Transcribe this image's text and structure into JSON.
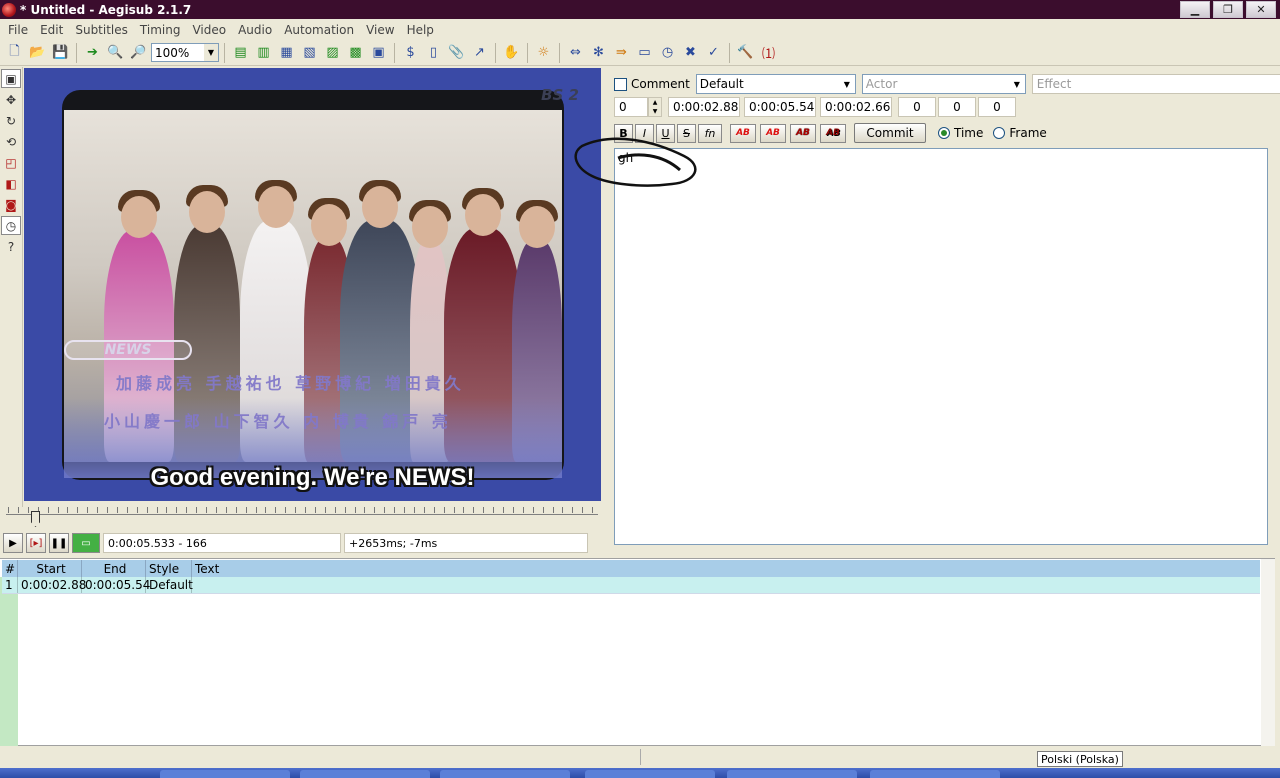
{
  "window": {
    "title": "* Untitled - Aegisub 2.1.7",
    "minimize": "▁",
    "restore": "❐",
    "close": "✕"
  },
  "menu": [
    "File",
    "Edit",
    "Subtitles",
    "Timing",
    "Video",
    "Audio",
    "Automation",
    "View",
    "Help"
  ],
  "toolbar": {
    "zoom": "100%"
  },
  "video": {
    "subtitle_text": "Good evening. We're NEWS!",
    "logo_text": "NEWS",
    "channel_mark": "BS 2",
    "names_row1": "加藤成亮 手越祐也 草野博紀 増田貴久",
    "names_row2": "小山慶一郎 山下智久 内 博貴 錦戸 亮"
  },
  "video_controls": {
    "time_position": "0:00:05.533 - 166",
    "offset": "+2653ms; -7ms"
  },
  "editor": {
    "comment_label": "Comment",
    "style": "Default",
    "actor_placeholder": "Actor",
    "effect_placeholder": "Effect",
    "layer": "0",
    "start_time": "0:00:02.88",
    "end_time": "0:00:05.54",
    "duration": "0:00:02.66",
    "margin_left": "0",
    "margin_right": "0",
    "margin_vertical": "0",
    "bold": "B",
    "italic": "I",
    "underline": "U",
    "strike": "S",
    "font": "fn",
    "color_label": "AB",
    "commit_label": "Commit",
    "time_label": "Time",
    "frame_label": "Frame",
    "text": "gh"
  },
  "grid": {
    "headers": [
      "#",
      "Start",
      "End",
      "Style",
      "Text"
    ],
    "rows": [
      {
        "num": "1",
        "start": "0:00:02.88",
        "end": "0:00:05.54",
        "style": "Default",
        "text": ""
      }
    ]
  },
  "status": {
    "language": "Polski (Polska)"
  }
}
